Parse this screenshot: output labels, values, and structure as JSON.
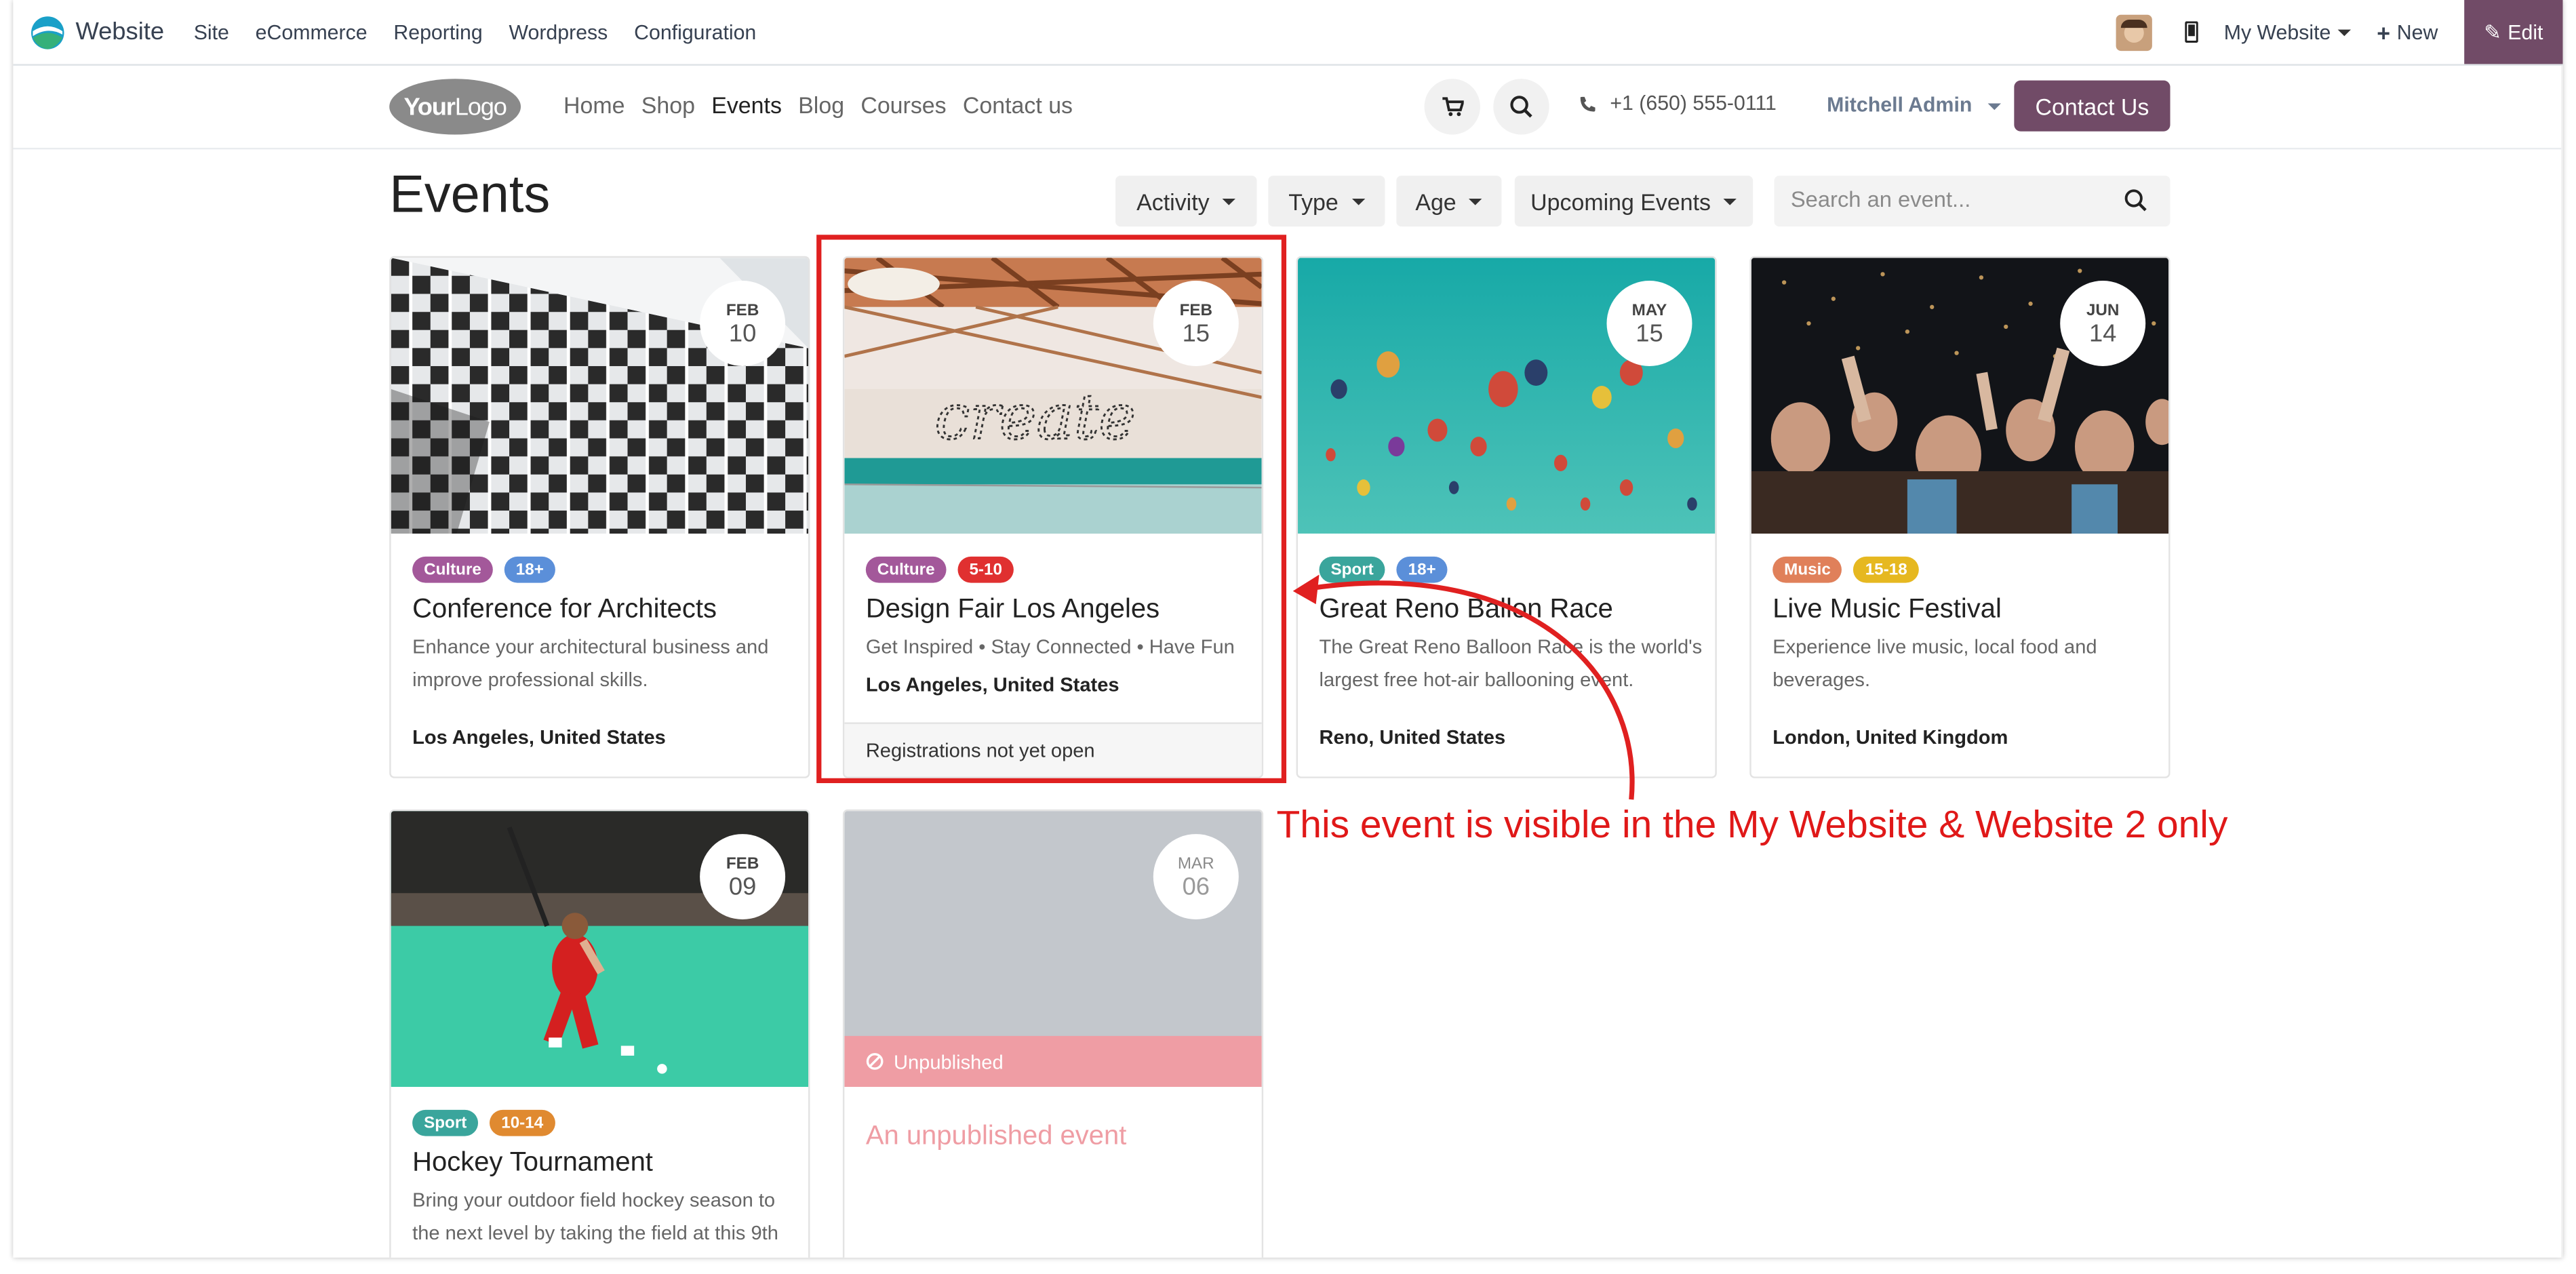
{
  "odoo_bar": {
    "app_name": "Website",
    "menu": [
      "Site",
      "eCommerce",
      "Reporting",
      "Wordpress",
      "Configuration"
    ],
    "website_switch": "My Website",
    "new_label": "New",
    "edit_label": "Edit"
  },
  "site_header": {
    "logo_bold": "Your",
    "logo_rest": "Logo",
    "nav": [
      "Home",
      "Shop",
      "Events",
      "Blog",
      "Courses",
      "Contact us"
    ],
    "active_nav": "Events",
    "phone": "+1 (650) 555-0111",
    "user": "Mitchell Admin",
    "contact_button": "Contact Us"
  },
  "events_page": {
    "title": "Events",
    "filters": [
      "Activity",
      "Type",
      "Age",
      "Upcoming Events"
    ],
    "search_placeholder": "Search an event..."
  },
  "events": [
    {
      "month": "FEB",
      "day": "10",
      "tags": [
        {
          "label": "Culture",
          "color": "#a3589a"
        },
        {
          "label": "18+",
          "color": "#5b8fd9"
        }
      ],
      "title": "Conference for Architects",
      "description": "Enhance your architectural business and improve professional skills.",
      "location": "Los Angeles, United States",
      "image": "building-photo"
    },
    {
      "month": "FEB",
      "day": "15",
      "tags": [
        {
          "label": "Culture",
          "color": "#a3589a"
        },
        {
          "label": "5-10",
          "color": "#e03030"
        }
      ],
      "title": "Design Fair Los Angeles",
      "description": "Get Inspired • Stay Connected • Have Fun",
      "location": "Los Angeles, United States",
      "footer": "Registrations not yet open",
      "image": "create-wall-photo"
    },
    {
      "month": "MAY",
      "day": "15",
      "tags": [
        {
          "label": "Sport",
          "color": "#3aa59c"
        },
        {
          "label": "18+",
          "color": "#5b8fd9"
        }
      ],
      "title": "Great Reno Ballon Race",
      "description": "The Great Reno Balloon Race is the world's largest free hot-air ballooning event.",
      "location": "Reno, United States",
      "image": "balloons-photo"
    },
    {
      "month": "JUN",
      "day": "14",
      "tags": [
        {
          "label": "Music",
          "color": "#e0805a"
        },
        {
          "label": "15-18",
          "color": "#e6b820"
        }
      ],
      "title": "Live Music Festival",
      "description": "Experience live music, local food and beverages.",
      "location": "London, United Kingdom",
      "image": "concert-crowd-photo"
    },
    {
      "month": "FEB",
      "day": "09",
      "tags": [
        {
          "label": "Sport",
          "color": "#3aa59c"
        },
        {
          "label": "10-14",
          "color": "#e08a30"
        }
      ],
      "title": "Hockey Tournament",
      "description": "Bring your outdoor field hockey season to the next level by taking the field at this 9th",
      "image": "hockey-player-photo"
    },
    {
      "month": "MAR",
      "day": "06",
      "status": "Unpublished",
      "title": "An unpublished event",
      "image": "placeholder-gray"
    }
  ],
  "annotation": {
    "text": "This event is visible in the My Website & Website 2 only",
    "color": "#e02020"
  }
}
